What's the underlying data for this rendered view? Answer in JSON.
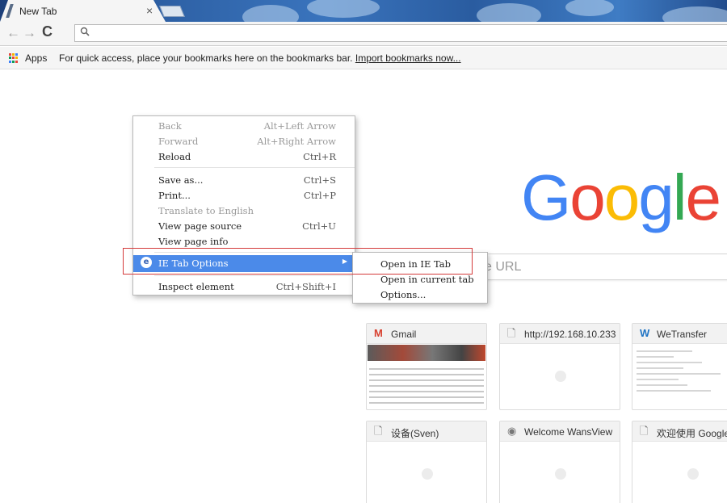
{
  "tab": {
    "title": "New Tab",
    "close": "×"
  },
  "toolbar": {
    "back": "←",
    "forward": "→",
    "reload": "C",
    "search_icon": "search-icon"
  },
  "bookmarks_bar": {
    "apps_label": "Apps",
    "message": "For quick access, place your bookmarks here on the bookmarks bar.",
    "import_link": "Import bookmarks now..."
  },
  "google_logo": {
    "letters": [
      {
        "ch": "G",
        "color": "#4285f4"
      },
      {
        "ch": "o",
        "color": "#ea4335"
      },
      {
        "ch": "o",
        "color": "#fbbc05"
      },
      {
        "ch": "g",
        "color": "#4285f4"
      },
      {
        "ch": "l",
        "color": "#34a853"
      },
      {
        "ch": "e",
        "color": "#ea4335"
      }
    ]
  },
  "search": {
    "placeholder_visible": "e URL"
  },
  "tiles": [
    {
      "title": "Gmail",
      "icon": "gmail-icon"
    },
    {
      "title": "http://192.168.10.233",
      "icon": "page-icon"
    },
    {
      "title": "WeTransfer",
      "icon": "wetransfer-icon"
    },
    {
      "title": "设备(Sven)",
      "icon": "page-icon"
    },
    {
      "title": "Welcome WansView",
      "icon": "eye-icon"
    },
    {
      "title": "欢迎使用 Google",
      "icon": "page-icon"
    }
  ],
  "context_menu": {
    "back": {
      "label": "Back",
      "shortcut": "Alt+Left Arrow"
    },
    "forward": {
      "label": "Forward",
      "shortcut": "Alt+Right Arrow"
    },
    "reload": {
      "label": "Reload",
      "shortcut": "Ctrl+R"
    },
    "save_as": {
      "label": "Save as...",
      "shortcut": "Ctrl+S"
    },
    "print": {
      "label": "Print...",
      "shortcut": "Ctrl+P"
    },
    "translate": {
      "label": "Translate to English"
    },
    "view_source": {
      "label": "View page source",
      "shortcut": "Ctrl+U"
    },
    "view_info": {
      "label": "View page info"
    },
    "ie_tab": {
      "label": "IE Tab Options",
      "icon": "e"
    },
    "inspect": {
      "label": "Inspect element",
      "shortcut": "Ctrl+Shift+I"
    }
  },
  "submenu": {
    "open_ie": "Open in IE Tab",
    "open_current": "Open in current tab",
    "options": "Options..."
  },
  "colors": {
    "menu_highlight": "#4b8ae9",
    "annotation_outline": "#d43a3a"
  }
}
